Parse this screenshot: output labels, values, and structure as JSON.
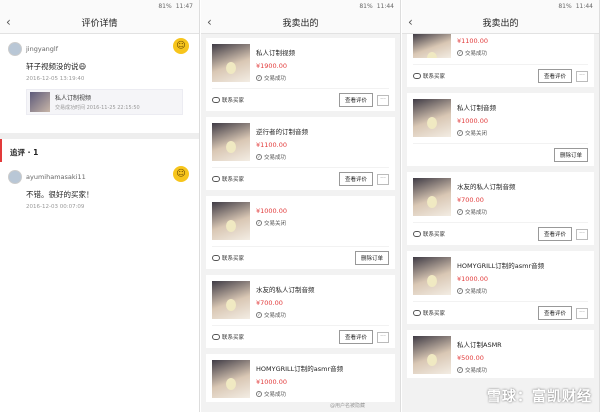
{
  "status": {
    "signal": "81%",
    "time1": "11:47",
    "time2": "11:44",
    "time3": "11:44"
  },
  "p1": {
    "title": "评价详情",
    "review": {
      "user": "jingyanglf",
      "text": "轩子视频没的说😄",
      "time": "2016-12-05 13:19:40"
    },
    "product": {
      "title": "私人订制视频",
      "sub": "交易成功时间 2016-11-25 22:15:50"
    },
    "followup_label": "追评 · 1",
    "review2": {
      "user": "ayumihamasaki11",
      "text": "不错。很好的买家！",
      "time": "2016-12-03 00:07:09"
    }
  },
  "p2": {
    "title": "我卖出的",
    "cards": [
      {
        "title": "私人订制视频",
        "price": "¥1900.00",
        "status": "交易成功",
        "contact": "联系买家",
        "action": "查看评价"
      },
      {
        "title": "逆行者的订制音频",
        "price": "¥1100.00",
        "status": "交易成功",
        "contact": "联系买家",
        "action": "查看评价"
      },
      {
        "title": "",
        "price": "¥1000.00",
        "status": "交易关闭",
        "contact": "联系买家",
        "action": "删除订单"
      },
      {
        "title": "水友的私人订制音频",
        "price": "¥700.00",
        "status": "交易成功",
        "contact": "联系买家",
        "action": "查看评价"
      },
      {
        "title": "HOMYGRILL订制的asmr音频",
        "price": "¥1000.00",
        "status": "交易成功"
      }
    ]
  },
  "p3": {
    "title": "我卖出的",
    "top": {
      "price": "¥1100.00",
      "status": "交易成功",
      "contact": "联系买家",
      "action": "查看评价"
    },
    "cards": [
      {
        "title": "私人订制音频",
        "price": "¥1000.00",
        "status": "交易关闭",
        "action": "删除订单"
      },
      {
        "title": "水友的私人订制音频",
        "price": "¥700.00",
        "status": "交易成功",
        "contact": "联系买家",
        "action": "查看评价"
      },
      {
        "title": "HOMYGRILL订制的asmr音频",
        "price": "¥1000.00",
        "status": "交易成功",
        "contact": "联系买家",
        "action": "查看评价"
      },
      {
        "title": "私人订制ASMR",
        "price": "¥500.00",
        "status": "交易成功"
      }
    ]
  },
  "watermark": "雪球：富凯财经",
  "wm_small": "@用户名被隐藏"
}
